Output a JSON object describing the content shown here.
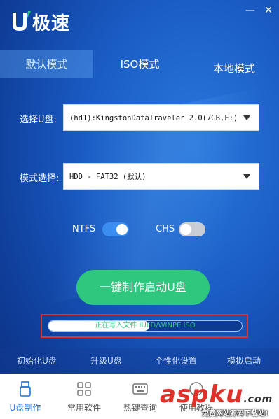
{
  "app": {
    "logo_text": "极速"
  },
  "window": {
    "minimize": "—",
    "close": "✕"
  },
  "tabs": [
    {
      "label": "默认模式",
      "active": true
    },
    {
      "label": "ISO模式",
      "active": false
    },
    {
      "label": "本地模式",
      "active": false
    }
  ],
  "form": {
    "usb_label": "选择U盘:",
    "usb_value": "(hd1):KingstonDataTraveler 2.0(7GB,F:)",
    "mode_label": "模式选择:",
    "mode_value": "HDD - FAT32 (默认)"
  },
  "toggles": {
    "ntfs": {
      "label": "NTFS",
      "on": true
    },
    "chs": {
      "label": "CHS",
      "on": false
    }
  },
  "actions": {
    "make_label": "一键制作启动U盘"
  },
  "progress": {
    "text": "正在写入文件 IUFD/WINPE.ISO",
    "fraction": 0.52
  },
  "tools": [
    "初始化U盘",
    "升级U盘",
    "个性化设置",
    "模拟启动"
  ],
  "bottom_nav": [
    {
      "label": "U盘制作",
      "icon": "usb-drive-icon",
      "active": true
    },
    {
      "label": "常用软件",
      "icon": "apps-grid-icon",
      "active": false
    },
    {
      "label": "热键查询",
      "icon": "keyboard-icon",
      "active": false
    },
    {
      "label": "使用教程",
      "icon": "help-icon",
      "active": false
    }
  ],
  "watermark": {
    "text": "aspku",
    "domain": ".com",
    "sub": "免费网站源码下载站!"
  },
  "colors": {
    "accent_green": "#2fc67d",
    "bg_blue": "#1a5cc4",
    "highlight_red": "#e03030",
    "active_blue": "#1c6fd8"
  }
}
